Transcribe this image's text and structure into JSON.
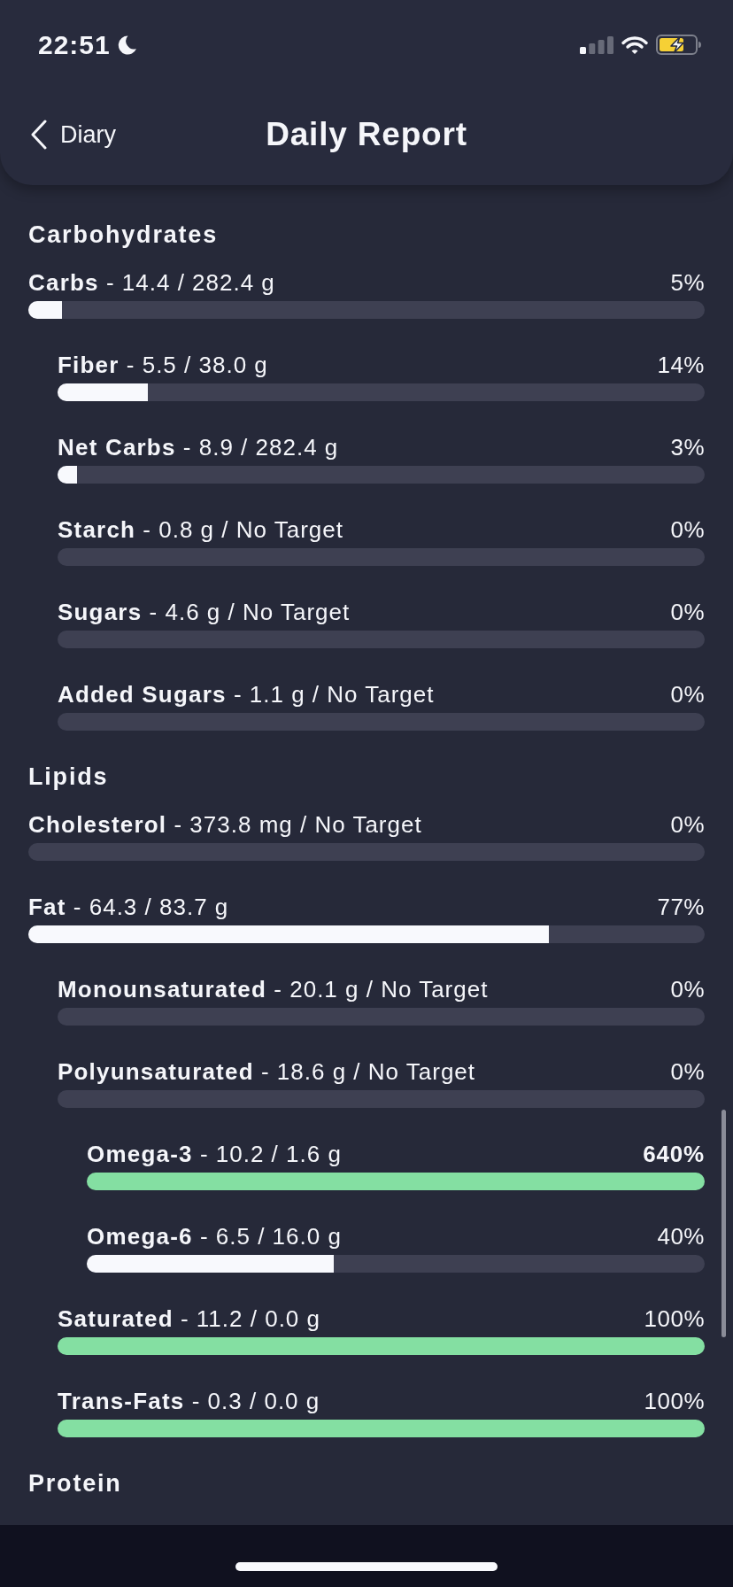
{
  "status_bar": {
    "time": "22:51"
  },
  "nav_bar": {
    "back_label": "Diary",
    "title": "Daily Report"
  },
  "sections": [
    {
      "title": "Carbohydrates",
      "nutrients": [
        {
          "label": "**Carbs** - 14.4 / 282.4 g",
          "percent": "5%",
          "level": 0.05,
          "color": "#f8f9fd",
          "highlighted": false,
          "children": [
            {
              "label": "**Fiber** - 5.5 / 38.0 g",
              "percent": "14%",
              "level": 0.14,
              "color": "#f8f9fd",
              "highlighted": false
            },
            {
              "label": "**Net Carbs** - 8.9 / 282.4 g",
              "percent": "3%",
              "level": 0.03,
              "color": "#f8f9fd",
              "highlighted": false
            },
            {
              "label": "**Starch** - 0.8 g / No Target",
              "percent": "0%",
              "highlighted": false
            },
            {
              "label": "**Sugars** - 4.6 g / No Target",
              "percent": "0%",
              "highlighted": false
            },
            {
              "label": "**Added Sugars** - 1.1 g / No Target",
              "percent": "0%",
              "highlighted": false
            }
          ]
        }
      ]
    },
    {
      "title": "Lipids",
      "nutrients": [
        {
          "label": "**Cholesterol** - 373.8 mg / No Target",
          "percent": "0%",
          "highlighted": false
        },
        {
          "label": "**Fat** - 64.3 / 83.7 g",
          "percent": "77%",
          "level": 0.77,
          "color": "#f8f9fd",
          "highlighted": false,
          "children": [
            {
              "label": "**Monounsaturated** - 20.1 g / No Target",
              "percent": "0%",
              "highlighted": false
            },
            {
              "label": "**Polyunsaturated** - 18.6 g / No Target",
              "percent": "0%",
              "highlighted": false,
              "children": [
                {
                  "label": "**Omega-3** - 10.2 / 1.6 g",
                  "percent": "640%",
                  "level": 1,
                  "color": "#84dfa2",
                  "highlighted": true
                },
                {
                  "label": "**Omega-6** - 6.5 / 16.0 g",
                  "percent": "40%",
                  "level": 0.4,
                  "color": "#f8f9fd",
                  "highlighted": false
                }
              ]
            },
            {
              "label": "**Saturated** - 11.2 / 0.0 g",
              "percent": "100%",
              "level": 1,
              "color": "#84dfa2",
              "highlighted": false
            },
            {
              "label": "**Trans-Fats** - 0.3 / 0.0 g",
              "percent": "100%",
              "level": 1,
              "color": "#84dfa2",
              "highlighted": false
            }
          ]
        }
      ]
    },
    {
      "title": "Protein"
    }
  ]
}
